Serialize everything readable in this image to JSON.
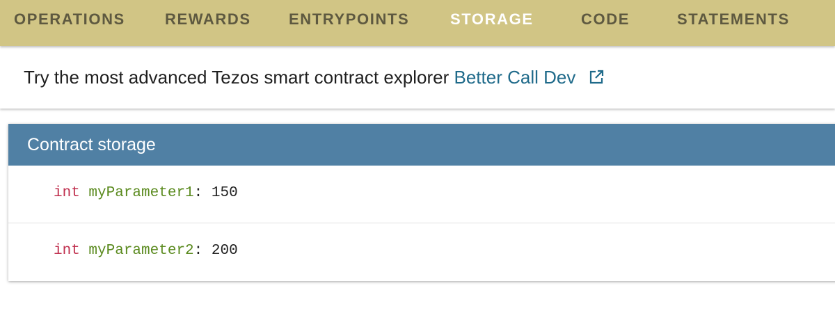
{
  "tabs": [
    {
      "label": "OPERATIONS",
      "active": false
    },
    {
      "label": "REWARDS",
      "active": false
    },
    {
      "label": "ENTRYPOINTS",
      "active": false
    },
    {
      "label": "STORAGE",
      "active": true
    },
    {
      "label": "CODE",
      "active": false
    },
    {
      "label": "STATEMENTS",
      "active": false
    }
  ],
  "banner": {
    "text": "Try the most advanced Tezos smart contract explorer",
    "link_label": "Better Call Dev",
    "link_icon": "open-in-new-icon"
  },
  "storage": {
    "title": "Contract storage",
    "rows": [
      {
        "type": "int",
        "name": "myParameter1",
        "separator": ":",
        "value": "150"
      },
      {
        "type": "int",
        "name": "myParameter2",
        "separator": ":",
        "value": "200"
      }
    ]
  },
  "colors": {
    "tabbar_bg": "#d1c585",
    "tab_text": "#5e5940",
    "tab_active_text": "#ffffff",
    "card_header_bg": "#5080a4",
    "link": "#1f6a8a",
    "type_keyword": "#c0304f",
    "param_name": "#5a8a1e"
  }
}
